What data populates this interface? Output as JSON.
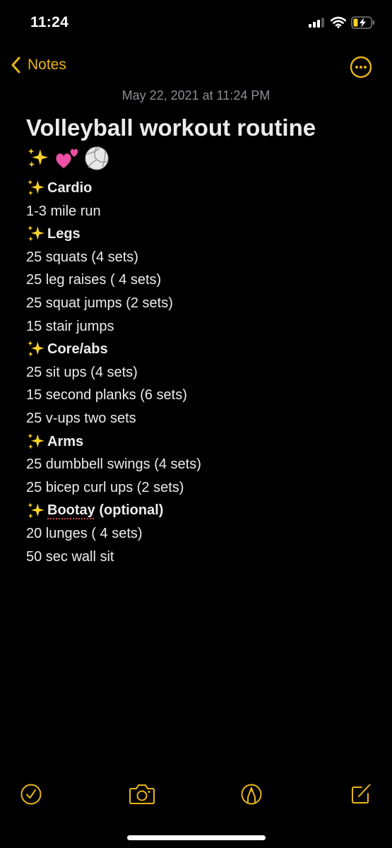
{
  "status_bar": {
    "time": "11:24",
    "signal_icon": "cellular-signal-icon",
    "wifi_icon": "wifi-icon",
    "battery_icon": "battery-charging-icon"
  },
  "nav": {
    "back_label": "Notes",
    "back_icon": "chevron-left-icon",
    "more_icon": "ellipsis-circle-icon"
  },
  "note": {
    "date": "May 22, 2021 at 11:24 PM",
    "title": "Volleyball workout routine",
    "title_emojis": [
      "sparkles",
      "two-hearts",
      "volleyball"
    ],
    "sections": [
      {
        "heading": "Cardio",
        "items": [
          "1-3 mile run"
        ]
      },
      {
        "heading": "Legs",
        "items": [
          "25 squats (4 sets)",
          "25 leg raises ( 4 sets)",
          "25 squat jumps (2 sets)",
          "15 stair jumps"
        ]
      },
      {
        "heading": "Core/abs",
        "items": [
          "25 sit ups (4 sets)",
          "15 second planks (6 sets)",
          "25 v-ups two sets"
        ]
      },
      {
        "heading": "Arms",
        "items": [
          "25 dumbbell swings (4 sets)",
          "25 bicep curl ups (2 sets)"
        ]
      },
      {
        "heading_misspelled": "Bootay",
        "heading_rest": " (optional)",
        "items": [
          "20 lunges ( 4 sets)",
          "50 sec wall sit"
        ]
      }
    ]
  },
  "toolbar": {
    "items": [
      "checklist-icon",
      "camera-icon",
      "markup-pen-icon",
      "compose-icon"
    ]
  },
  "colors": {
    "accent": "#E8B518",
    "background": "#000000",
    "text": "#ECECEC",
    "secondary_text": "#8E8E93",
    "spellcheck": "#E0403A"
  }
}
